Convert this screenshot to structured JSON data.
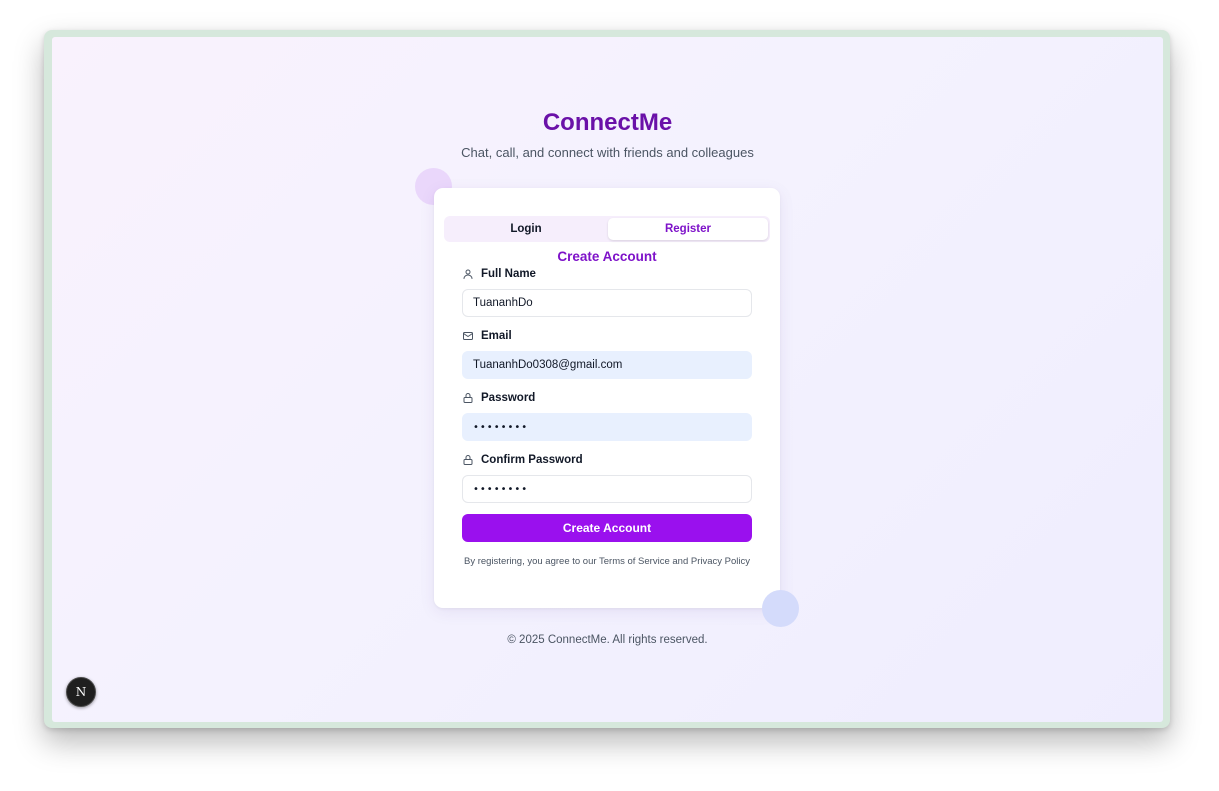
{
  "app": {
    "title": "ConnectMe",
    "tagline": "Chat, call, and connect with friends and colleagues"
  },
  "tabs": {
    "login_label": "Login",
    "register_label": "Register",
    "active": "Register"
  },
  "form": {
    "title": "Create Account",
    "full_name": {
      "label": "Full Name",
      "value": "TuananhDo",
      "icon": "user-icon"
    },
    "email": {
      "label": "Email",
      "value": "TuananhDo0308@gmail.com",
      "icon": "mail-icon"
    },
    "password": {
      "label": "Password",
      "value": "••••••••",
      "icon": "lock-icon"
    },
    "confirm_password": {
      "label": "Confirm Password",
      "value": "••••••••",
      "icon": "lock-icon"
    },
    "submit_label": "Create Account",
    "terms_text": "By registering, you agree to our Terms of Service and Privacy Policy"
  },
  "footer": {
    "copyright": "© 2025 ConnectMe. All rights reserved."
  },
  "dev_badge": {
    "letter": "N",
    "icon": "nextjs-icon"
  },
  "colors": {
    "brand_purple": "#6a11a8",
    "accent_purple": "#7e12c9",
    "button_purple": "#9a10ee",
    "autofill_blue": "#e8f0fe"
  }
}
